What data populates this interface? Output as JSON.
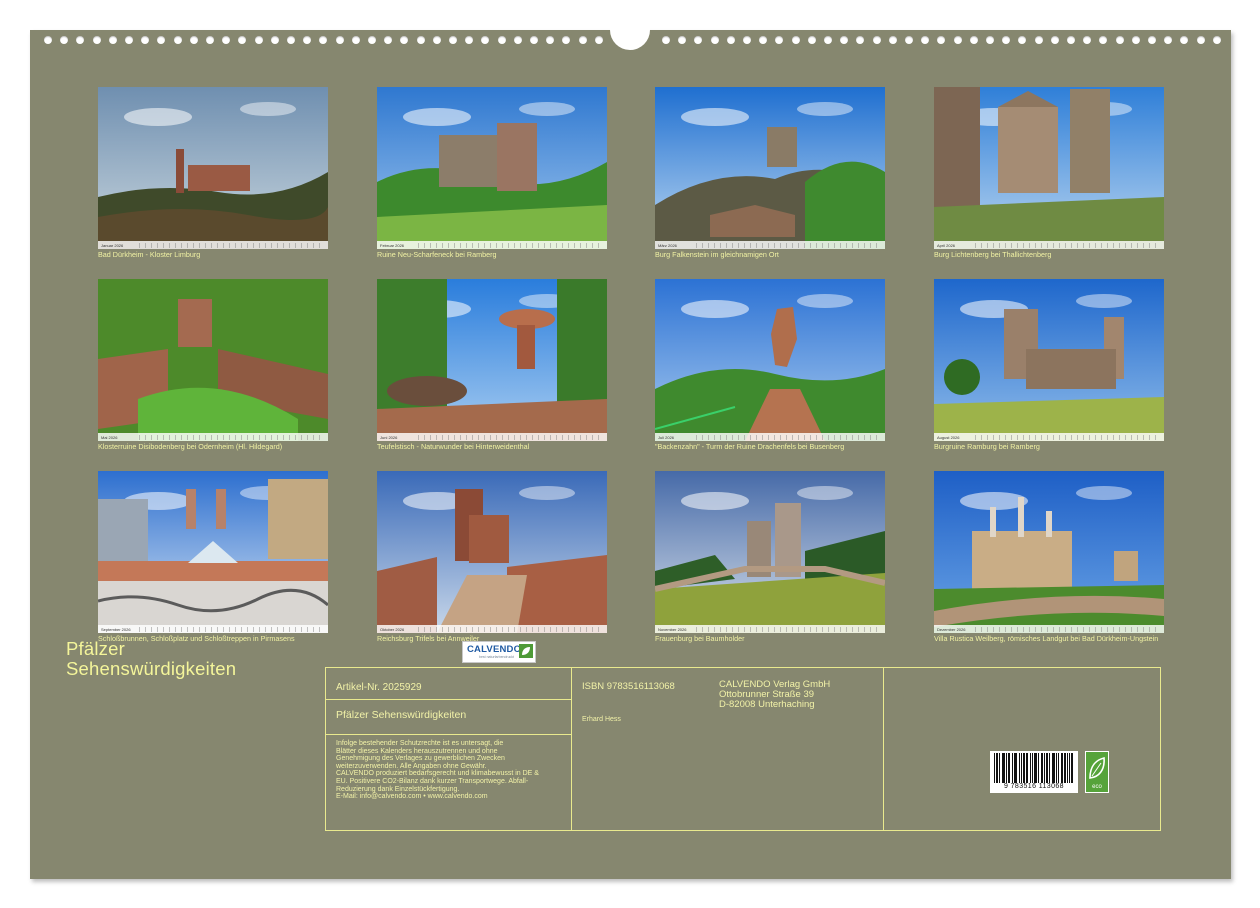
{
  "title": "Pfälzer Sehenswürdigkeiten",
  "title_lines": [
    "Pfälzer",
    "Sehenswürdigkeiten"
  ],
  "colors": {
    "background": "#86876f",
    "caption_text": "#f1f2a4",
    "info_border": "#e9e98e",
    "calvendo_blue": "#1f5aa3",
    "eco_green": "#56a33a"
  },
  "months": [
    {
      "month_label": "Januar 2026",
      "caption": "Bad Dürkheim - Kloster Limburg",
      "scene": "ruin-forest-sunset"
    },
    {
      "month_label": "Februar 2026",
      "caption": "Ruine Neu-Scharfeneck bei Ramberg",
      "scene": "ruin-green-hills"
    },
    {
      "month_label": "März 2026",
      "caption": "Burg Falkenstein im gleichnamigen Ort",
      "scene": "castle-on-rock-blue-sky"
    },
    {
      "month_label": "April 2026",
      "caption": "Burg Lichtenberg bei Thallichtenberg",
      "scene": "castle-courtyard"
    },
    {
      "month_label": "Mai 2026",
      "caption": "Klosterruine Disibodenberg bei Odernheim (Hl. Hildegard)",
      "scene": "monastery-ruin-green"
    },
    {
      "month_label": "Juni 2026",
      "caption": "Teufelstisch - Naturwunder bei Hinterweidenthal",
      "scene": "rock-table-forest"
    },
    {
      "month_label": "Juli 2026",
      "caption": "\"Backenzahn\" - Turm der Ruine Drachenfels bei Busenberg",
      "scene": "rock-tower-sky"
    },
    {
      "month_label": "August 2026",
      "caption": "Burgruine Ramburg bei Ramberg",
      "scene": "castle-ruin-blue-sky"
    },
    {
      "month_label": "September 2026",
      "caption": "Schloßbrunnen, Schloßplatz und Schloßtreppen in Pirmasens",
      "scene": "town-fountain"
    },
    {
      "month_label": "Oktober 2026",
      "caption": "Reichsburg Trifels bei Annweiler",
      "scene": "castle-tower-red-sandstone"
    },
    {
      "month_label": "November 2026",
      "caption": "Frauenburg bei Baumholder",
      "scene": "round-tower-meadow"
    },
    {
      "month_label": "Dezember 2026",
      "caption": "Villa Rustica Weilberg, römisches Landgut bei Bad Dürkheim-Ungstein",
      "scene": "roman-columns"
    }
  ],
  "info": {
    "article_number": "Artikel-Nr. 2025929",
    "product_title": "Pfälzer Sehenswürdigkeiten",
    "legal_lines": [
      "Infolge bestehender Schutzrechte ist es untersagt, die",
      "Blätter dieses Kalenders herauszutrennen und ohne",
      "Genehmigung des Verlages zu gewerblichen Zwecken",
      "weiterzuverwenden. Alle Angaben ohne Gewähr.",
      "CALVENDO produziert bedarfsgerecht und klimabewusst in DE &",
      "EU. Positivere CO2-Bilanz dank kurzer Transportwege. Abfall-",
      "Reduzierung dank Einzelstückfertigung.",
      "E-Mail: info@calvendo.com • www.calvendo.com"
    ],
    "isbn": "ISBN 9783516113068",
    "author": "Erhard Hess",
    "publisher_lines": [
      "CALVENDO Verlag GmbH",
      "Ottobrunner Straße 39",
      "D-82008 Unterhaching"
    ],
    "logo_name": "CALVENDO",
    "logo_subline": "best naturfarbendruckt",
    "barcode_digits": "9 783516 113068",
    "eco_label": "eco"
  }
}
